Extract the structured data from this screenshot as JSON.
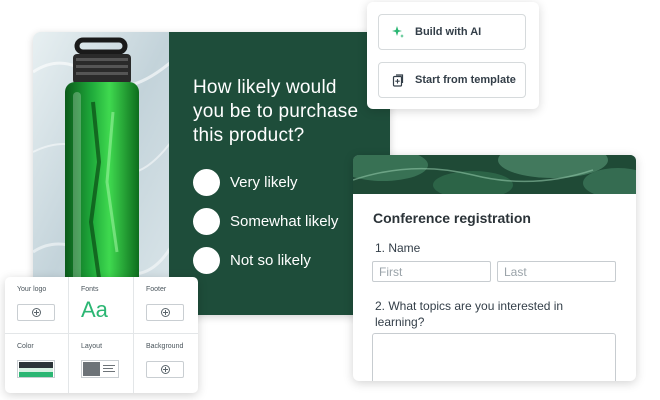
{
  "survey": {
    "question": "How likely would you be to purchase this product?",
    "options": [
      "Very likely",
      "Somewhat likely",
      "Not so likely"
    ],
    "panel_color": "#1e4d3a"
  },
  "start_menu": {
    "ai_button": {
      "label": "Build with AI",
      "icon": "sparkle-icon"
    },
    "template_button": {
      "label": "Start from template",
      "icon": "template-icon"
    }
  },
  "registration": {
    "title": "Conference registration",
    "q1_label": "1. Name",
    "first_placeholder": "First",
    "last_placeholder": "Last",
    "q2_label": "2. What topics are you interested in learning?"
  },
  "theme": {
    "logo_label": "Your logo",
    "fonts_label": "Fonts",
    "font_sample": "Aa",
    "footer_label": "Footer",
    "color_label": "Color",
    "layout_label": "Layout",
    "background_label": "Background",
    "accent_color": "#2bb673"
  }
}
